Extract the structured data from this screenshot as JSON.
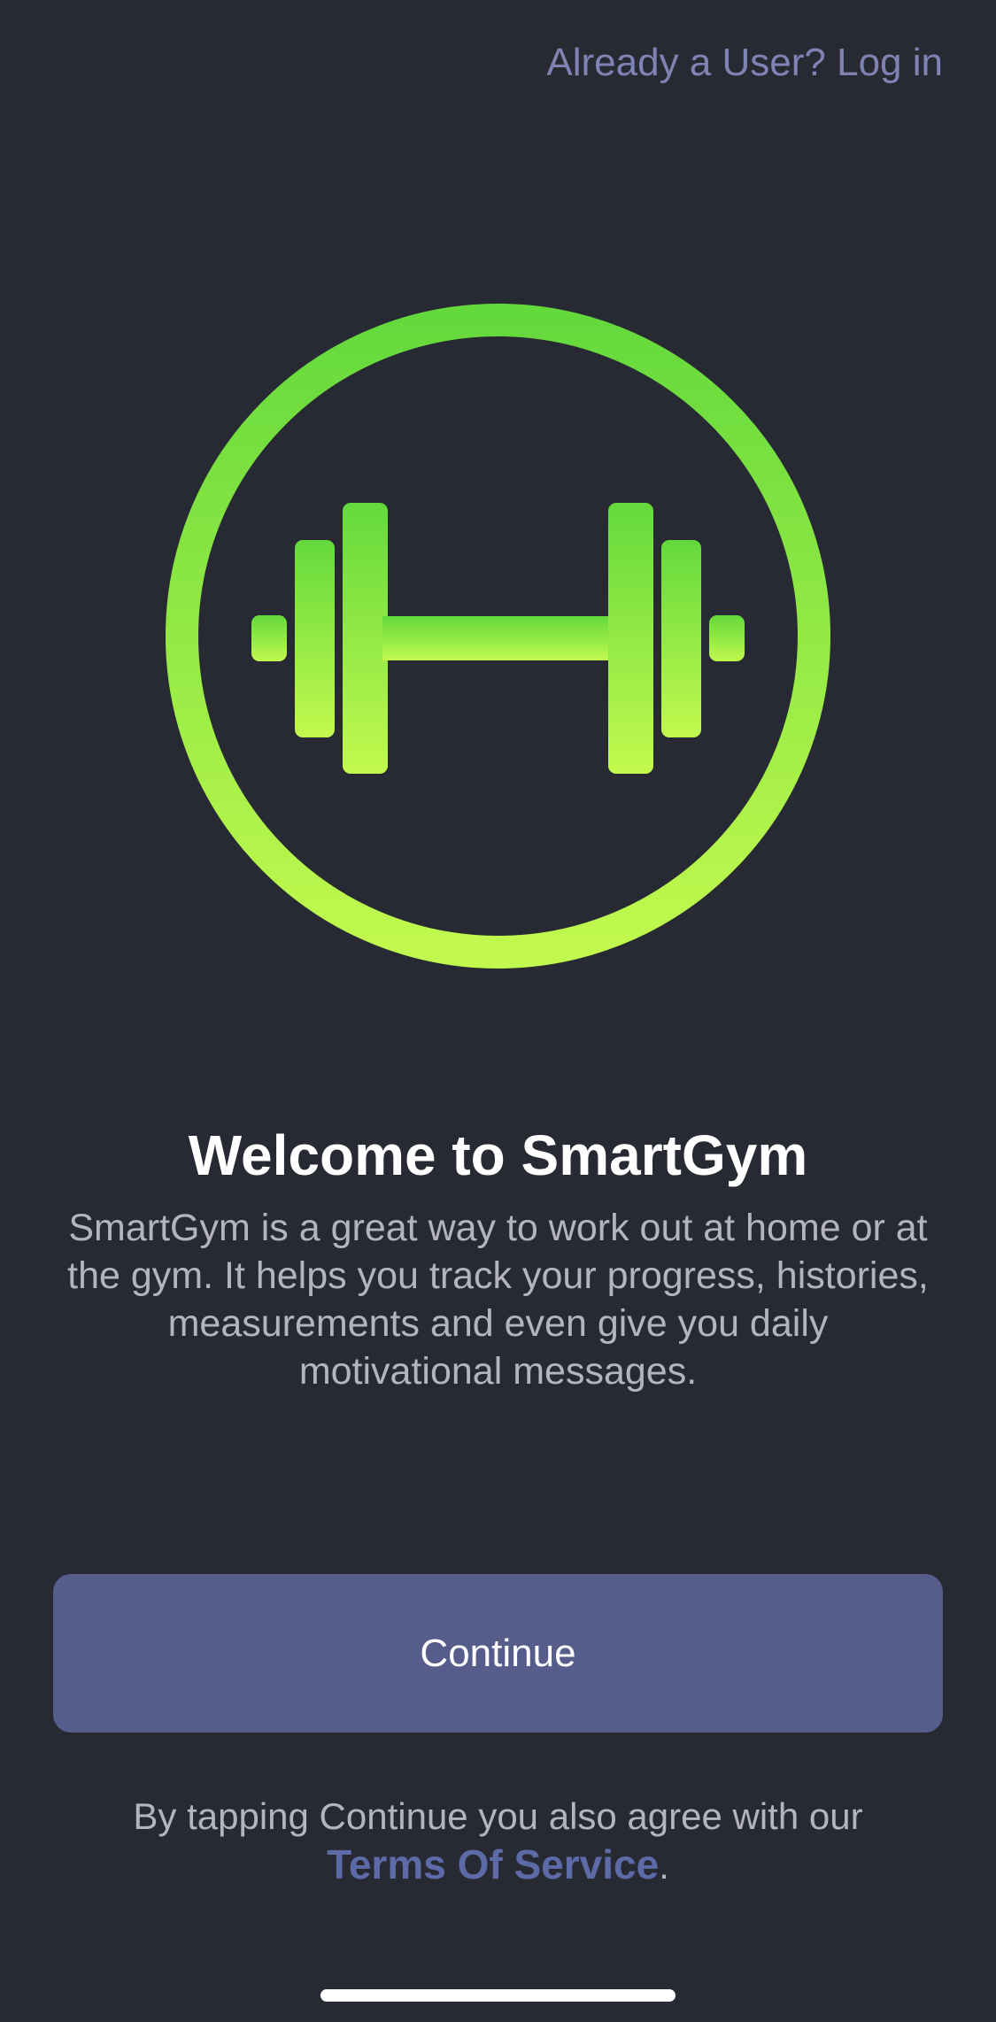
{
  "header": {
    "login_link": "Already a User? Log in"
  },
  "logo": {
    "icon": "dumbbell-icon",
    "gradient_top": "#64d93c",
    "gradient_bottom": "#c2f94e"
  },
  "welcome": {
    "title": "Welcome to SmartGym",
    "description": "SmartGym is a great way to work out at home or at the gym. It helps you track your progress, histories, measurements and even give you daily motivational messages."
  },
  "actions": {
    "continue_label": "Continue"
  },
  "legal": {
    "prefix": "By tapping Continue you also agree with our",
    "link": "Terms Of Service",
    "suffix": "."
  },
  "colors": {
    "background": "#282a33",
    "accent": "#575d8a",
    "link": "#7f83b3"
  }
}
